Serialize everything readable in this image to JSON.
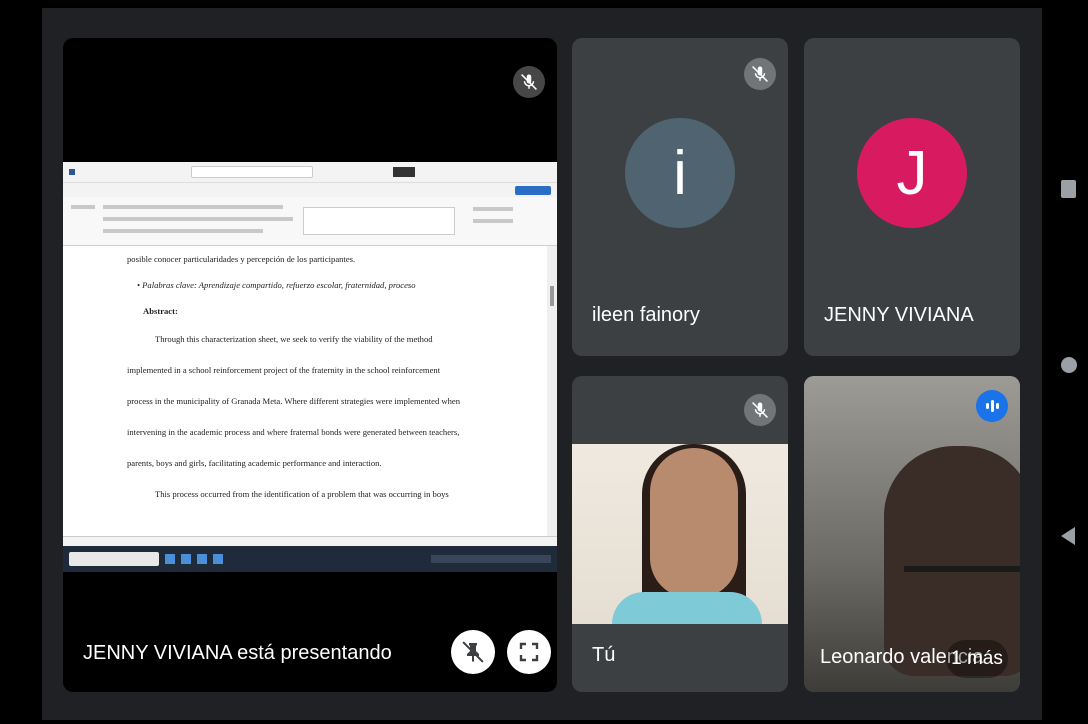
{
  "presentation": {
    "presenter_label": "JENNY VIVIANA está presentando",
    "document_lines": [
      "posible conocer particularidades y percepción de los participantes.",
      "• Palabras clave: Aprendizaje compartido, refuerzo escolar, fraternidad, proceso",
      "Abstract:",
      "Through this characterization sheet, we seek to verify the viability of the method",
      "implemented in a school reinforcement project of the fraternity in the school reinforcement",
      "process in the municipality of Granada Meta. Where different strategies were implemented when",
      "intervening in the academic process and where fraternal bonds were generated between teachers,",
      "parents, boys and girls, facilitating academic performance and interaction.",
      "This process occurred from the identification of a problem that was occurring in boys"
    ]
  },
  "participants": [
    {
      "name": "ileen fainory",
      "initial": "i",
      "avatar_color": "#4f6470",
      "muted": true
    },
    {
      "name": "JENNY VIVIANA",
      "initial": "J",
      "avatar_color": "#d81b60",
      "muted": false
    },
    {
      "name": "Tú",
      "muted": true,
      "video": true
    },
    {
      "name": "Leonardo valencia",
      "speaking": true,
      "video": true
    }
  ],
  "more_count_label": "1 más",
  "colors": {
    "tile_bg": "#3c4043",
    "stage_bg": "#202124",
    "speaking": "#1a73e8"
  }
}
